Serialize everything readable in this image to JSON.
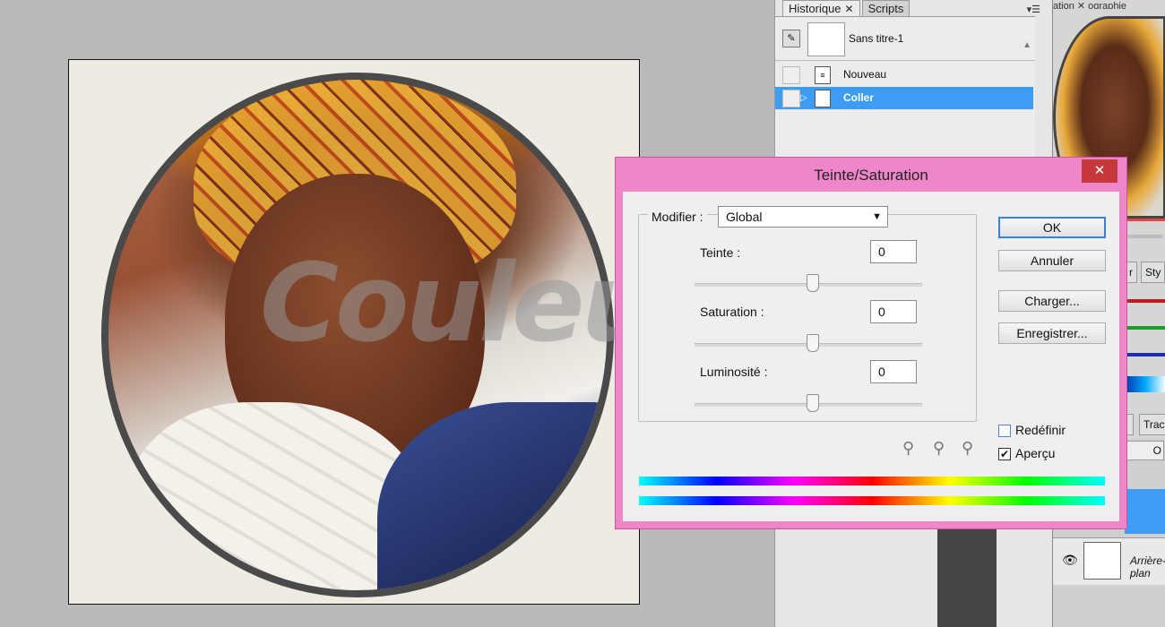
{
  "dialog": {
    "title": "Teinte/Saturation",
    "close_glyph": "✕",
    "modifier_label": "Modifier :",
    "modifier_value": "Global",
    "hue_label": "Teinte :",
    "hue_value": "0",
    "saturation_label": "Saturation :",
    "saturation_value": "0",
    "lightness_label": "Luminosité :",
    "lightness_value": "0",
    "ok": "OK",
    "cancel": "Annuler",
    "load": "Charger...",
    "save": "Enregistrer...",
    "colorize_label": "Redéfinir",
    "colorize_checked": false,
    "preview_label": "Aperçu",
    "preview_checked": true,
    "title_bar_color": "#ee86c9"
  },
  "history_panel": {
    "tabs": [
      "Historique",
      "Scripts"
    ],
    "tab_close": "✕",
    "snapshot_label": "Sans titre-1",
    "items": [
      {
        "label": "Nouveau",
        "selected": false
      },
      {
        "label": "Coller",
        "selected": true
      }
    ]
  },
  "right_panel": {
    "tab_fragment": "ation ✕ ographie",
    "mini_tabs": [
      "r",
      "Sty"
    ],
    "layer_tabs": [
      "",
      "Trac"
    ],
    "layer_name": "Arrière-plan",
    "blend_fragment": "O"
  },
  "canvas": {
    "watermark_text": "Couleur RVB"
  },
  "icons": {
    "eye": "eye-icon",
    "dropper": "eyedropper-icon",
    "dropper_plus": "eyedropper-plus-icon",
    "dropper_minus": "eyedropper-minus-icon",
    "document": "document-icon",
    "panel_menu": "panel-menu-icon"
  }
}
